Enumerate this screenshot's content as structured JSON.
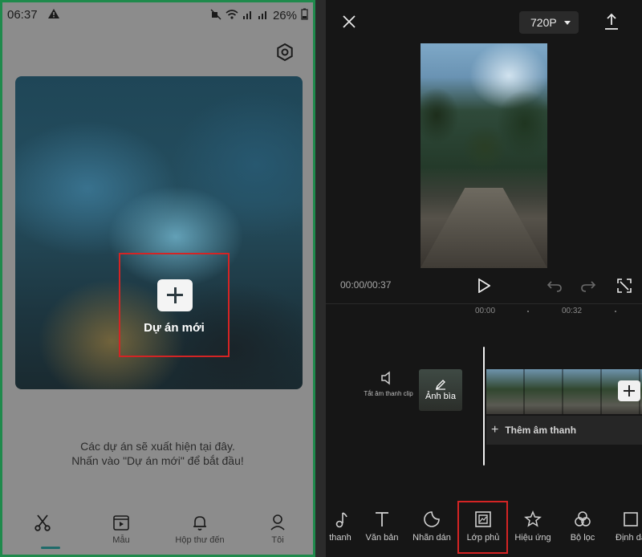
{
  "left_phone": {
    "status": {
      "time": "06:37",
      "battery": "26%"
    },
    "new_project_label": "Dự án mới",
    "empty_line1": "Các dự án sẽ xuất hiện tại đây.",
    "empty_line2": "Nhấn vào \"Dự án mới\" để bắt đầu!",
    "tabs": [
      {
        "label": "",
        "icon": "scissors-icon"
      },
      {
        "label": "Mẫu",
        "icon": "template-icon"
      },
      {
        "label": "Hộp thư đến",
        "icon": "bell-icon"
      },
      {
        "label": "Tôi",
        "icon": "profile-icon"
      }
    ]
  },
  "right_phone": {
    "resolution": "720P",
    "timecode": "00:00/00:37",
    "ruler": {
      "t0": "00:00",
      "t1": "00:32"
    },
    "mute_label": "Tắt âm thanh clip",
    "cover_label": "Ảnh bìa",
    "add_audio_label": "Thêm âm thanh",
    "tools": [
      {
        "label": "thanh",
        "icon": "music-note-icon"
      },
      {
        "label": "Văn bản",
        "icon": "text-icon"
      },
      {
        "label": "Nhãn dán",
        "icon": "sticker-icon"
      },
      {
        "label": "Lớp phủ",
        "icon": "overlay-icon"
      },
      {
        "label": "Hiệu ứng",
        "icon": "effects-icon"
      },
      {
        "label": "Bộ lọc",
        "icon": "filter-icon"
      },
      {
        "label": "Định dạ",
        "icon": "format-icon"
      }
    ]
  },
  "colors": {
    "highlight": "#d42424",
    "accent": "#1f6b6a",
    "frame": "#1f8a4c"
  }
}
